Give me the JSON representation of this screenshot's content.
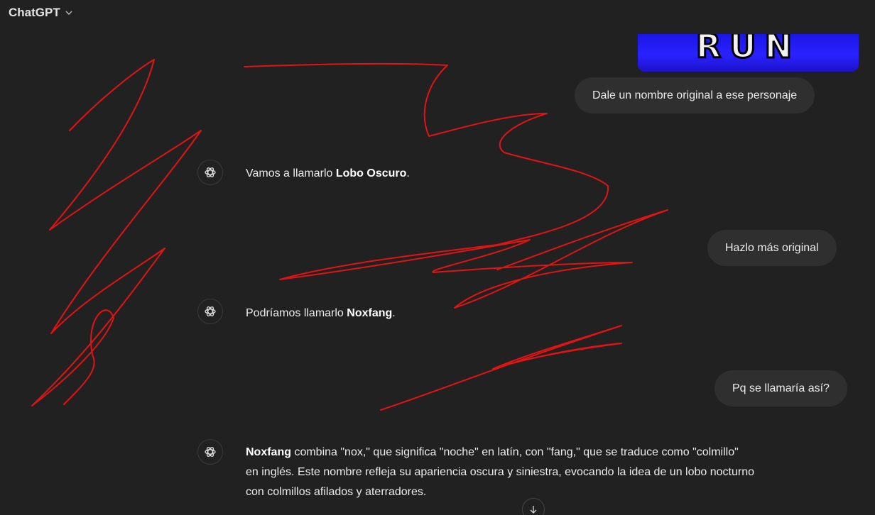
{
  "header": {
    "model_label": "ChatGPT"
  },
  "image_preview": {
    "text": "RUN"
  },
  "messages": [
    {
      "role": "user",
      "text": "Dale un nombre original a ese personaje"
    },
    {
      "role": "assistant",
      "prefix": "Vamos a llamarlo ",
      "bold": "Lobo Oscuro",
      "suffix": "."
    },
    {
      "role": "user",
      "text": "Hazlo más original"
    },
    {
      "role": "assistant",
      "prefix": "Podríamos llamarlo ",
      "bold": "Noxfang",
      "suffix": "."
    },
    {
      "role": "user",
      "text": "Pq se llamaría así?"
    },
    {
      "role": "assistant",
      "bold": "Noxfang",
      "line1_rest": " combina \"nox,\" que significa \"noche\" en latín, con \"fang,\" que se traduce como \"colmillo\"",
      "line2": "en inglés. Este nombre refleja su apariencia oscura y siniestra, evocando la idea de un lobo nocturno",
      "line3": "con colmillos afilados y aterradores."
    }
  ],
  "icons": {
    "model_chevron": "chevron-down-icon",
    "assistant_avatar": "openai-logo-icon",
    "scroll_button": "arrow-down-icon"
  },
  "colors": {
    "scribble": "#e01414",
    "background": "#212121",
    "bubble": "#2f2f2f"
  }
}
